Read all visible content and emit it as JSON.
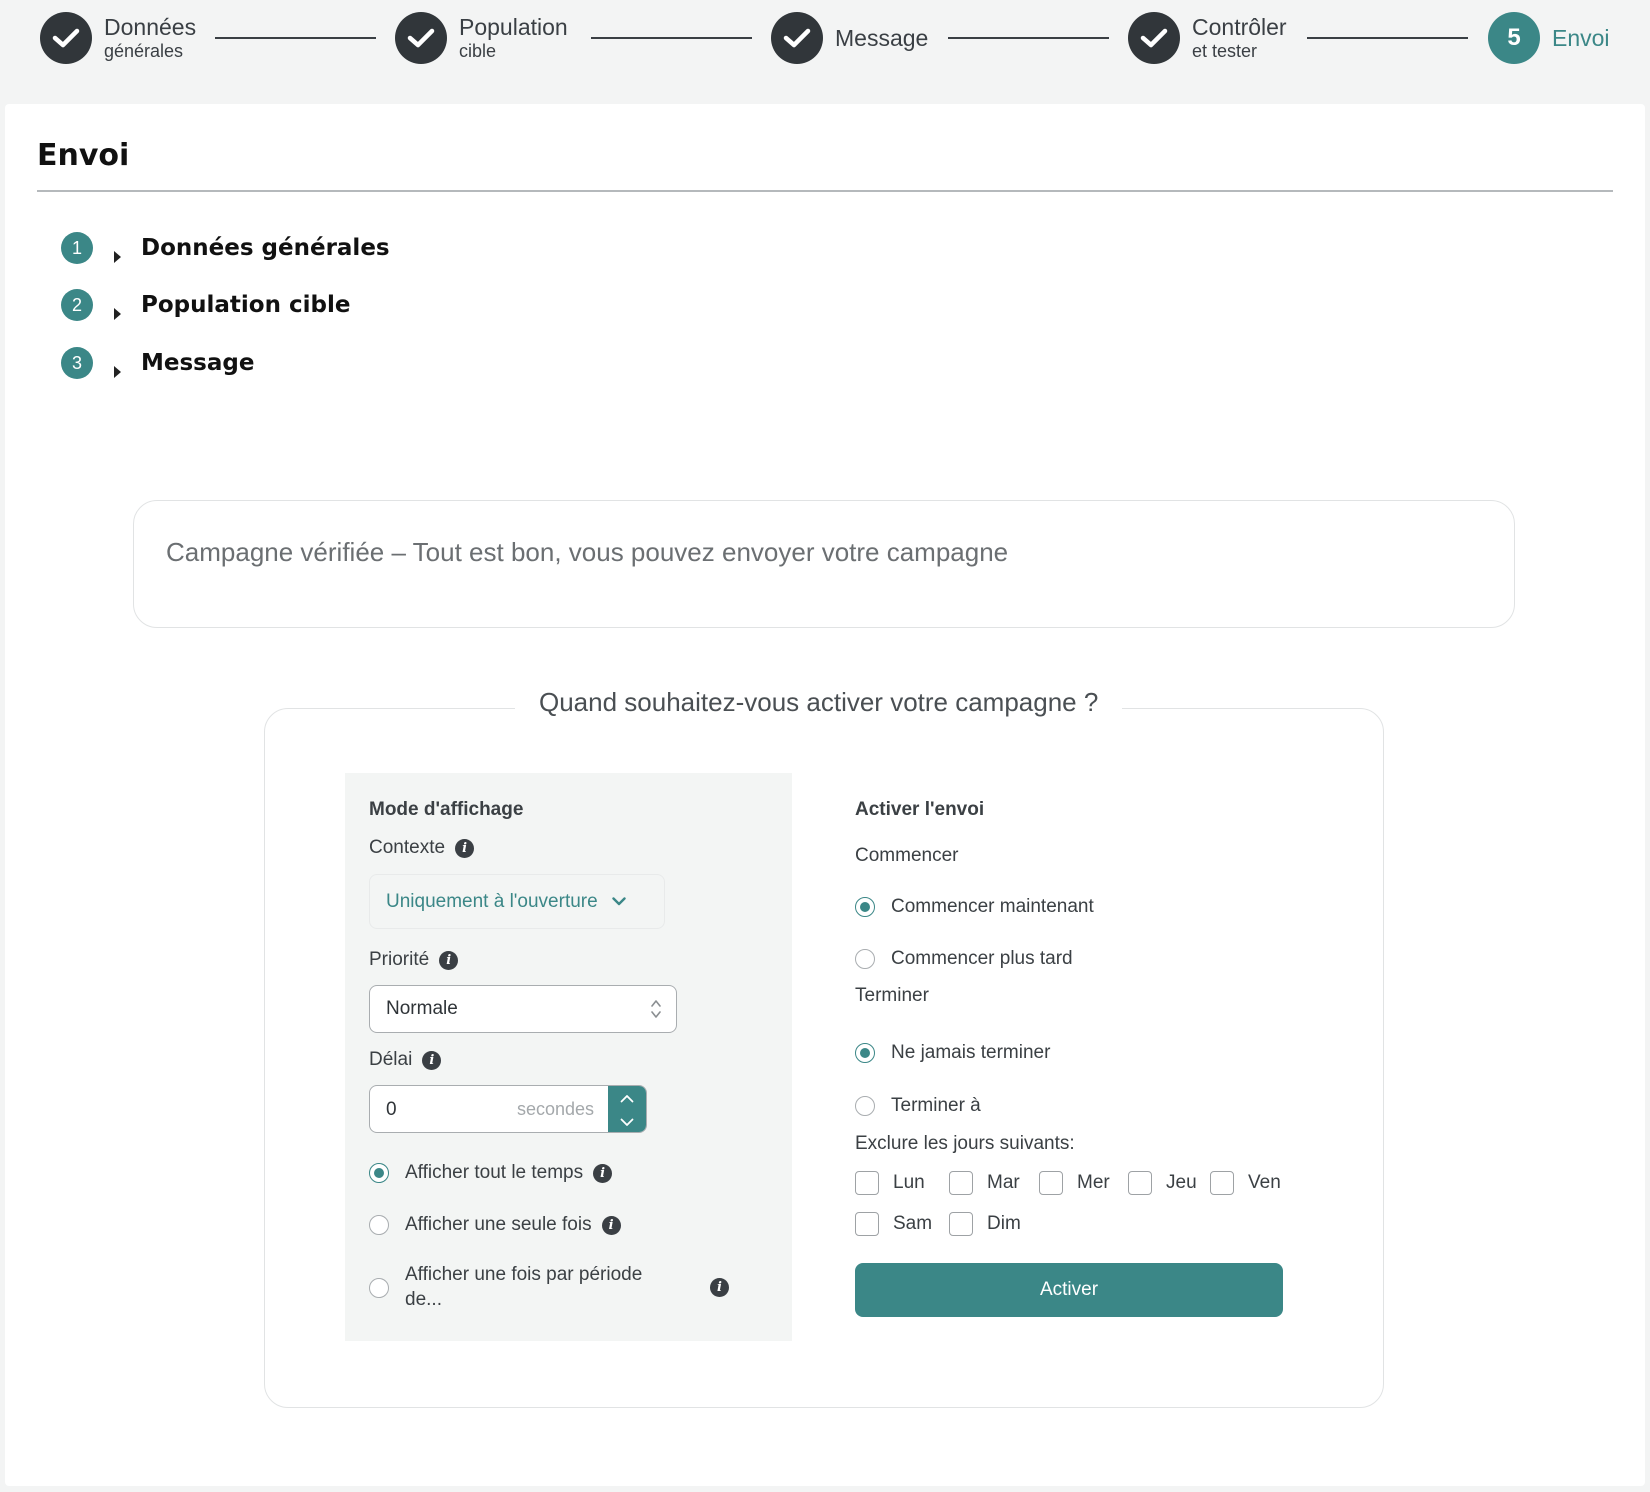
{
  "stepper": {
    "steps": [
      {
        "title": "Données",
        "subtitle": "générales",
        "state": "done"
      },
      {
        "title": "Population",
        "subtitle": "cible",
        "state": "done"
      },
      {
        "title": "Message",
        "subtitle": "",
        "state": "done"
      },
      {
        "title": "Contrôler",
        "subtitle": "et tester",
        "state": "done"
      },
      {
        "title": "Envoi",
        "subtitle": "",
        "number": "5",
        "state": "active"
      }
    ]
  },
  "page": {
    "title": "Envoi"
  },
  "summary": [
    {
      "number": "1",
      "label": "Données générales"
    },
    {
      "number": "2",
      "label": "Population cible"
    },
    {
      "number": "3",
      "label": "Message"
    }
  ],
  "notice": {
    "text": "Campagne vérifiée – Tout est bon, vous pouvez envoyer votre campagne"
  },
  "activation": {
    "legend": "Quand souhaitez-vous activer votre campagne ?",
    "display_mode": {
      "title": "Mode d'affichage",
      "context_label": "Contexte",
      "context_value": "Uniquement à l'ouverture",
      "priority_label": "Priorité",
      "priority_value": "Normale",
      "delay_label": "Délai",
      "delay_value": "0",
      "delay_unit": "secondes",
      "options": [
        {
          "label": "Afficher tout le temps",
          "checked": true
        },
        {
          "label": "Afficher une seule fois",
          "checked": false
        },
        {
          "label": "Afficher une fois par période de...",
          "checked": false
        }
      ]
    },
    "send": {
      "title": "Activer l'envoi",
      "start_label": "Commencer",
      "start_options": [
        {
          "label": "Commencer maintenant",
          "checked": true
        },
        {
          "label": "Commencer plus tard",
          "checked": false
        }
      ],
      "end_label": "Terminer",
      "end_options": [
        {
          "label": "Ne jamais terminer",
          "checked": true
        },
        {
          "label": "Terminer à",
          "checked": false
        }
      ],
      "exclude_label": "Exclure les jours suivants:",
      "days": [
        "Lun",
        "Mar",
        "Mer",
        "Jeu",
        "Ven",
        "Sam",
        "Dim"
      ],
      "activate_button": "Activer"
    }
  },
  "colors": {
    "accent": "#3b8787",
    "done_step": "#31363a"
  }
}
